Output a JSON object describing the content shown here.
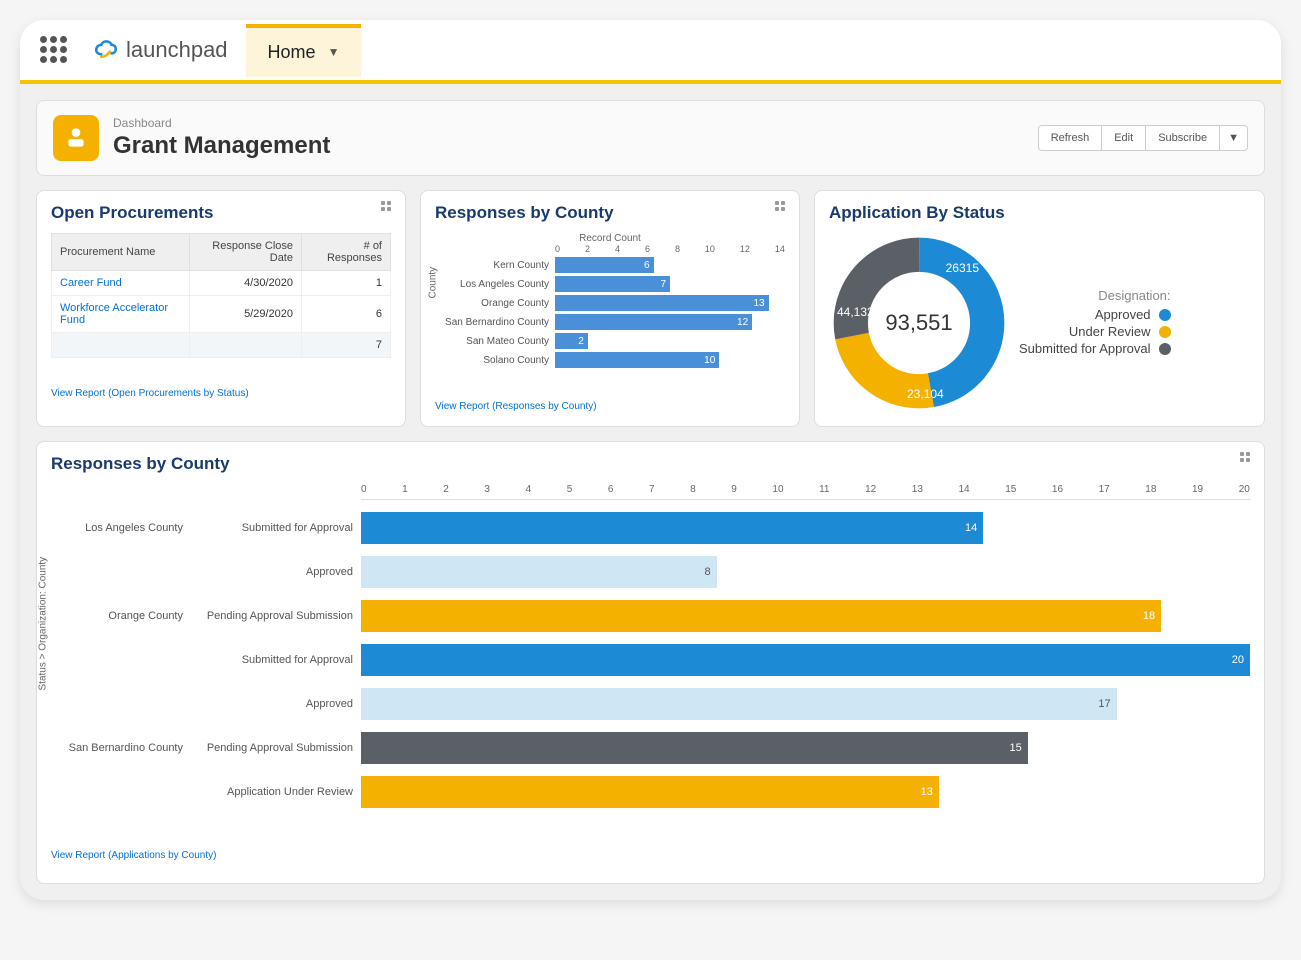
{
  "topbar": {
    "brand_text": "launchpad",
    "home_tab": "Home"
  },
  "header": {
    "sub": "Dashboard",
    "title": "Grant Management",
    "actions": {
      "refresh": "Refresh",
      "edit": "Edit",
      "subscribe": "Subscribe"
    }
  },
  "open_procurements": {
    "title": "Open Procurements",
    "cols": {
      "name": "Procurement Name",
      "close": "Response Close Date",
      "resp": "# of Responses"
    },
    "rows": [
      {
        "name": "Career Fund",
        "close": "4/30/2020",
        "resp": 1
      },
      {
        "name": "Workforce Accelerator Fund",
        "close": "5/29/2020",
        "resp": 6
      }
    ],
    "total": 7,
    "footer": "View Report (Open Procurements by Status)"
  },
  "responses_by_county": {
    "title": "Responses by County",
    "axis_title": "Record Count",
    "y_label": "County",
    "footer": "View Report (Responses by County)"
  },
  "application_by_status": {
    "title": "Application By Status",
    "legend_header": "Designation:",
    "total": "93,551",
    "segments": {
      "approved": {
        "label": "Approved",
        "value_label": "44,132",
        "color": "#1d8ad6"
      },
      "under_review": {
        "label": "Under Review",
        "value_label": "23,104",
        "color": "#f5b100"
      },
      "submitted": {
        "label": "Submitted for Approval",
        "value_label": "26315",
        "color": "#5b5f66"
      }
    }
  },
  "big_chart": {
    "title": "Responses by County",
    "y_label": "Status > Organization: County",
    "footer": "View Report (Applications by County)"
  },
  "chart_data": [
    {
      "id": "responses_by_county_small",
      "type": "bar",
      "orientation": "horizontal",
      "xlabel": "Record Count",
      "ylabel": "County",
      "xlim": [
        0,
        14
      ],
      "xticks": [
        0,
        2,
        4,
        6,
        8,
        10,
        12,
        14
      ],
      "categories": [
        "Kern County",
        "Los Angeles County",
        "Orange County",
        "San Bernardino County",
        "San Mateo County",
        "Solano County"
      ],
      "values": [
        6,
        7,
        13,
        12,
        2,
        10
      ],
      "color": "#4a90d9"
    },
    {
      "id": "application_by_status_donut",
      "type": "pie",
      "title": "Application By Status",
      "total": 93551,
      "series": [
        {
          "name": "Approved",
          "value": 44132,
          "color": "#1d8ad6"
        },
        {
          "name": "Under Review",
          "value": 23104,
          "color": "#f5b100"
        },
        {
          "name": "Submitted for Approval",
          "value": 26315,
          "color": "#5b5f66"
        }
      ]
    },
    {
      "id": "responses_by_county_large",
      "type": "bar",
      "orientation": "horizontal",
      "ylabel": "Status > Organization: County",
      "xlim": [
        0,
        20
      ],
      "xticks": [
        0,
        1,
        2,
        3,
        4,
        5,
        6,
        7,
        8,
        9,
        10,
        11,
        12,
        13,
        14,
        15,
        16,
        17,
        18,
        19,
        20
      ],
      "rows": [
        {
          "county": "Los Angeles County",
          "status": "Submitted for Approval",
          "value": 14,
          "color": "#1d8ad6"
        },
        {
          "county": "",
          "status": "Approved",
          "value": 8,
          "color": "#cfe6f5"
        },
        {
          "county": "Orange County",
          "status": "Pending Approval Submission",
          "value": 18,
          "color": "#f5b100"
        },
        {
          "county": "",
          "status": "Submitted for Approval",
          "value": 20,
          "color": "#1d8ad6"
        },
        {
          "county": "",
          "status": "Approved",
          "value": 17,
          "color": "#cfe6f5"
        },
        {
          "county": "San Bernardino County",
          "status": "Pending Approval Submission",
          "value": 15,
          "color": "#5b5f66"
        },
        {
          "county": "",
          "status": "Application Under Review",
          "value": 13,
          "color": "#f5b100"
        }
      ]
    }
  ]
}
